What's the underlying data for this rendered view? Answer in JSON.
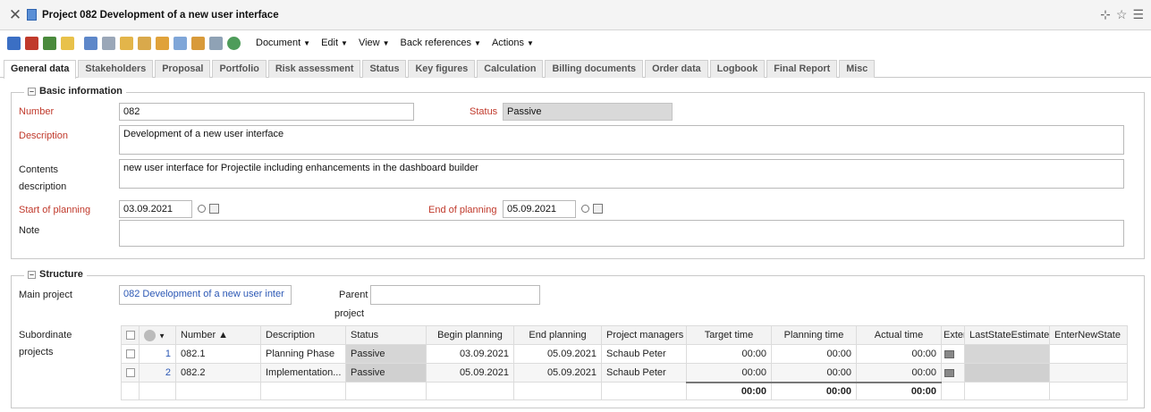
{
  "window": {
    "title": "Project 082 Development of a new user interface"
  },
  "toolbar": {
    "menus": [
      "Document",
      "Edit",
      "View",
      "Back references",
      "Actions"
    ]
  },
  "tabs": [
    "General data",
    "Stakeholders",
    "Proposal",
    "Portfolio",
    "Risk assessment",
    "Status",
    "Key figures",
    "Calculation",
    "Billing documents",
    "Order data",
    "Logbook",
    "Final Report",
    "Misc"
  ],
  "basic": {
    "legend": "Basic information",
    "number_label": "Number",
    "number_value": "082",
    "status_label": "Status",
    "status_value": "Passive",
    "description_label": "Description",
    "description_value": "Development of a new user interface",
    "contents_label_1": "Contents",
    "contents_label_2": "description",
    "contents_value": "new user interface for Projectile including enhancements in the dashboard builder",
    "start_label": "Start of planning",
    "start_value": "03.09.2021",
    "end_label": "End of planning",
    "end_value": "05.09.2021",
    "note_label": "Note",
    "note_value": ""
  },
  "structure": {
    "legend": "Structure",
    "main_label": "Main project",
    "main_value": "082 Development of a new user inter",
    "parent_label_1": "Parent",
    "parent_label_2": "project",
    "parent_value": "",
    "sub_label_1": "Subordinate",
    "sub_label_2": "projects"
  },
  "grid": {
    "columns": [
      "Number ▲",
      "Description",
      "Status",
      "Begin planning",
      "End planning",
      "Project managers",
      "Target time",
      "Planning time",
      "Actual time",
      "Exter",
      "LastStateEstimate",
      "EnterNewState"
    ],
    "rows": [
      {
        "idx": "1",
        "number": "082.1",
        "description": "Planning Phase",
        "status": "Passive",
        "begin": "03.09.2021",
        "end": "05.09.2021",
        "managers": "Schaub Peter",
        "target": "00:00",
        "planning": "00:00",
        "actual": "00:00"
      },
      {
        "idx": "2",
        "number": "082.2",
        "description": "Implementation...",
        "status": "Passive",
        "begin": "05.09.2021",
        "end": "05.09.2021",
        "managers": "Schaub Peter",
        "target": "00:00",
        "planning": "00:00",
        "actual": "00:00"
      }
    ],
    "totals": {
      "target": "00:00",
      "planning": "00:00",
      "actual": "00:00"
    }
  },
  "colors": {
    "required_label": "#c0392b",
    "link": "#2c58b5",
    "readonly_bg": "#d9d9d9"
  }
}
